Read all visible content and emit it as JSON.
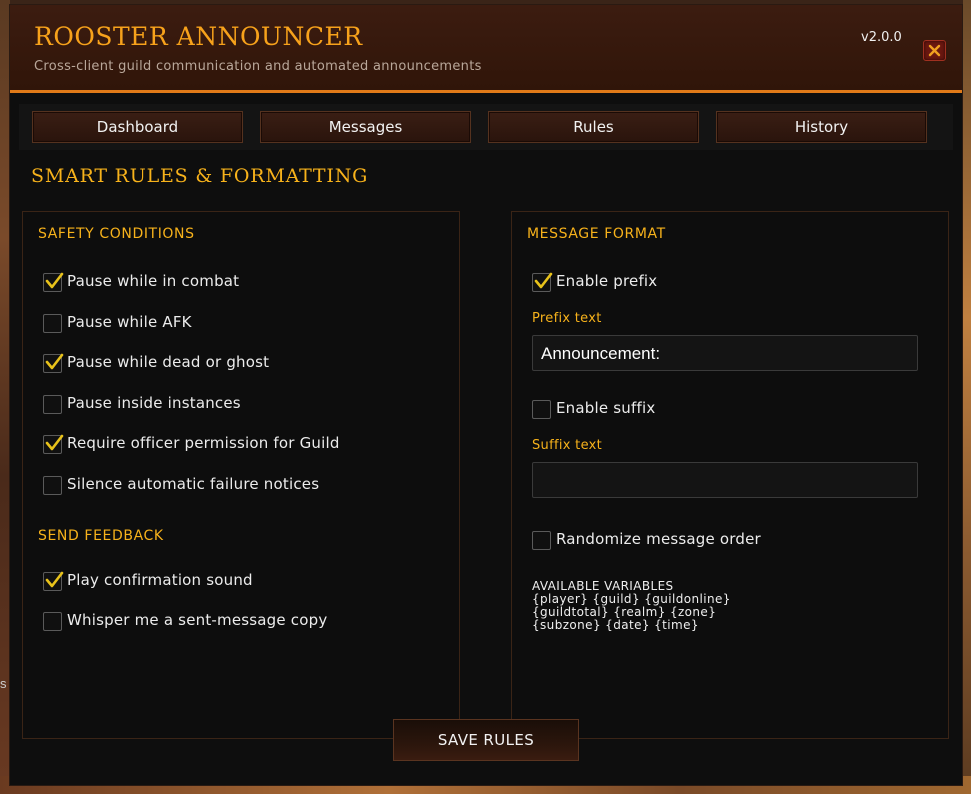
{
  "header": {
    "title": "ROOSTER ANNOUNCER",
    "subtitle": "Cross-client guild communication and automated announcements",
    "version": "v2.0.0",
    "close_icon": "close-icon"
  },
  "tabs": [
    {
      "label": "Dashboard"
    },
    {
      "label": "Messages"
    },
    {
      "label": "Rules",
      "active": true
    },
    {
      "label": "History"
    }
  ],
  "page_title": "SMART RULES & FORMATTING",
  "safety": {
    "heading": "SAFETY CONDITIONS",
    "items": [
      {
        "label": "Pause while in combat",
        "checked": true
      },
      {
        "label": "Pause while AFK",
        "checked": false
      },
      {
        "label": "Pause while dead or ghost",
        "checked": true
      },
      {
        "label": "Pause inside instances",
        "checked": false
      },
      {
        "label": "Require officer permission for Guild",
        "checked": true
      },
      {
        "label": "Silence automatic failure notices",
        "checked": false
      }
    ]
  },
  "feedback": {
    "heading": "SEND FEEDBACK",
    "items": [
      {
        "label": "Play confirmation sound",
        "checked": true
      },
      {
        "label": "Whisper me a sent-message copy",
        "checked": false
      }
    ]
  },
  "format": {
    "heading": "MESSAGE FORMAT",
    "enable_prefix": {
      "label": "Enable prefix",
      "checked": true
    },
    "prefix_label": "Prefix text",
    "prefix_value": "Announcement:",
    "enable_suffix": {
      "label": "Enable suffix",
      "checked": false
    },
    "suffix_label": "Suffix text",
    "suffix_value": "",
    "randomize": {
      "label": "Randomize message order",
      "checked": false
    },
    "variables_heading": "AVAILABLE VARIABLES",
    "variables_line1": "{player}  {guild}  {guildonline}",
    "variables_line2": "{guildtotal}  {realm}  {zone}",
    "variables_line3": "{subzone}  {date}  {time}"
  },
  "save_button": "SAVE RULES",
  "colors": {
    "accent": "#f7b21b",
    "header_bg": "#3c1c10",
    "header_border": "#e07a18",
    "check": "#e8c21a"
  }
}
